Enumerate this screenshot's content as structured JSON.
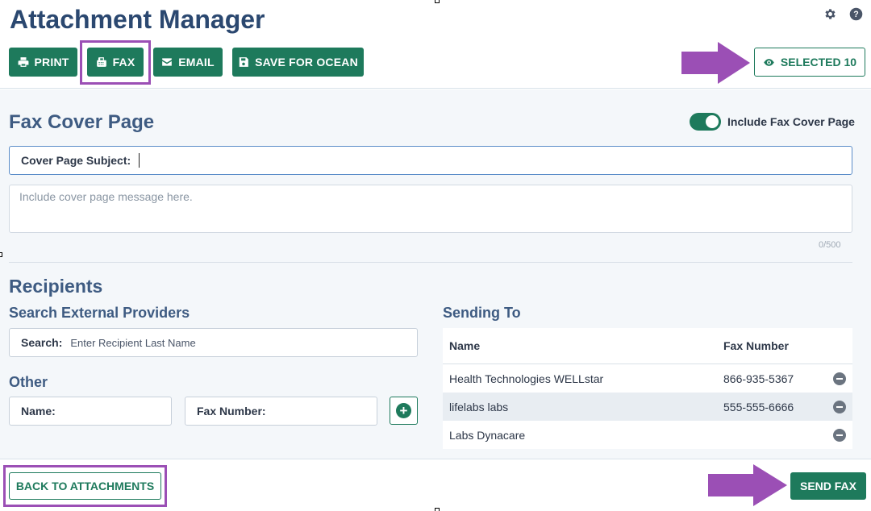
{
  "header": {
    "title": "Attachment Manager",
    "icons": [
      "gear-icon",
      "help-icon"
    ]
  },
  "toolbar": {
    "print_label": "PRINT",
    "fax_label": "FAX",
    "email_label": "EMAIL",
    "save_ocean_label": "SAVE FOR OCEAN",
    "selected_label": "SELECTED 10"
  },
  "fax_cover": {
    "title": "Fax Cover Page",
    "toggle_label": "Include Fax Cover Page",
    "toggle_on": true,
    "subject_label": "Cover Page Subject:",
    "subject_value": "",
    "message_placeholder": "Include cover page message here.",
    "counter": "0/500"
  },
  "recipients": {
    "title": "Recipients",
    "search_title": "Search External Providers",
    "search_label": "Search:",
    "search_placeholder": "Enter Recipient Last Name",
    "other_title": "Other",
    "name_label": "Name:",
    "fax_label": "Fax Number:"
  },
  "sending_to": {
    "title": "Sending To",
    "columns": [
      "Name",
      "Fax Number"
    ],
    "rows": [
      {
        "name": "Health Technologies WELLstar",
        "fax": "866-935-5367"
      },
      {
        "name": "lifelabs labs",
        "fax": "555-555-6666"
      },
      {
        "name": "Labs Dynacare",
        "fax": ""
      }
    ]
  },
  "footer": {
    "back_label": "BACK TO ATTACHMENTS",
    "send_label": "SEND FAX"
  },
  "colors": {
    "accent": "#1e7a5c",
    "title": "#2b4870",
    "highlight": "#9b4fb5"
  }
}
